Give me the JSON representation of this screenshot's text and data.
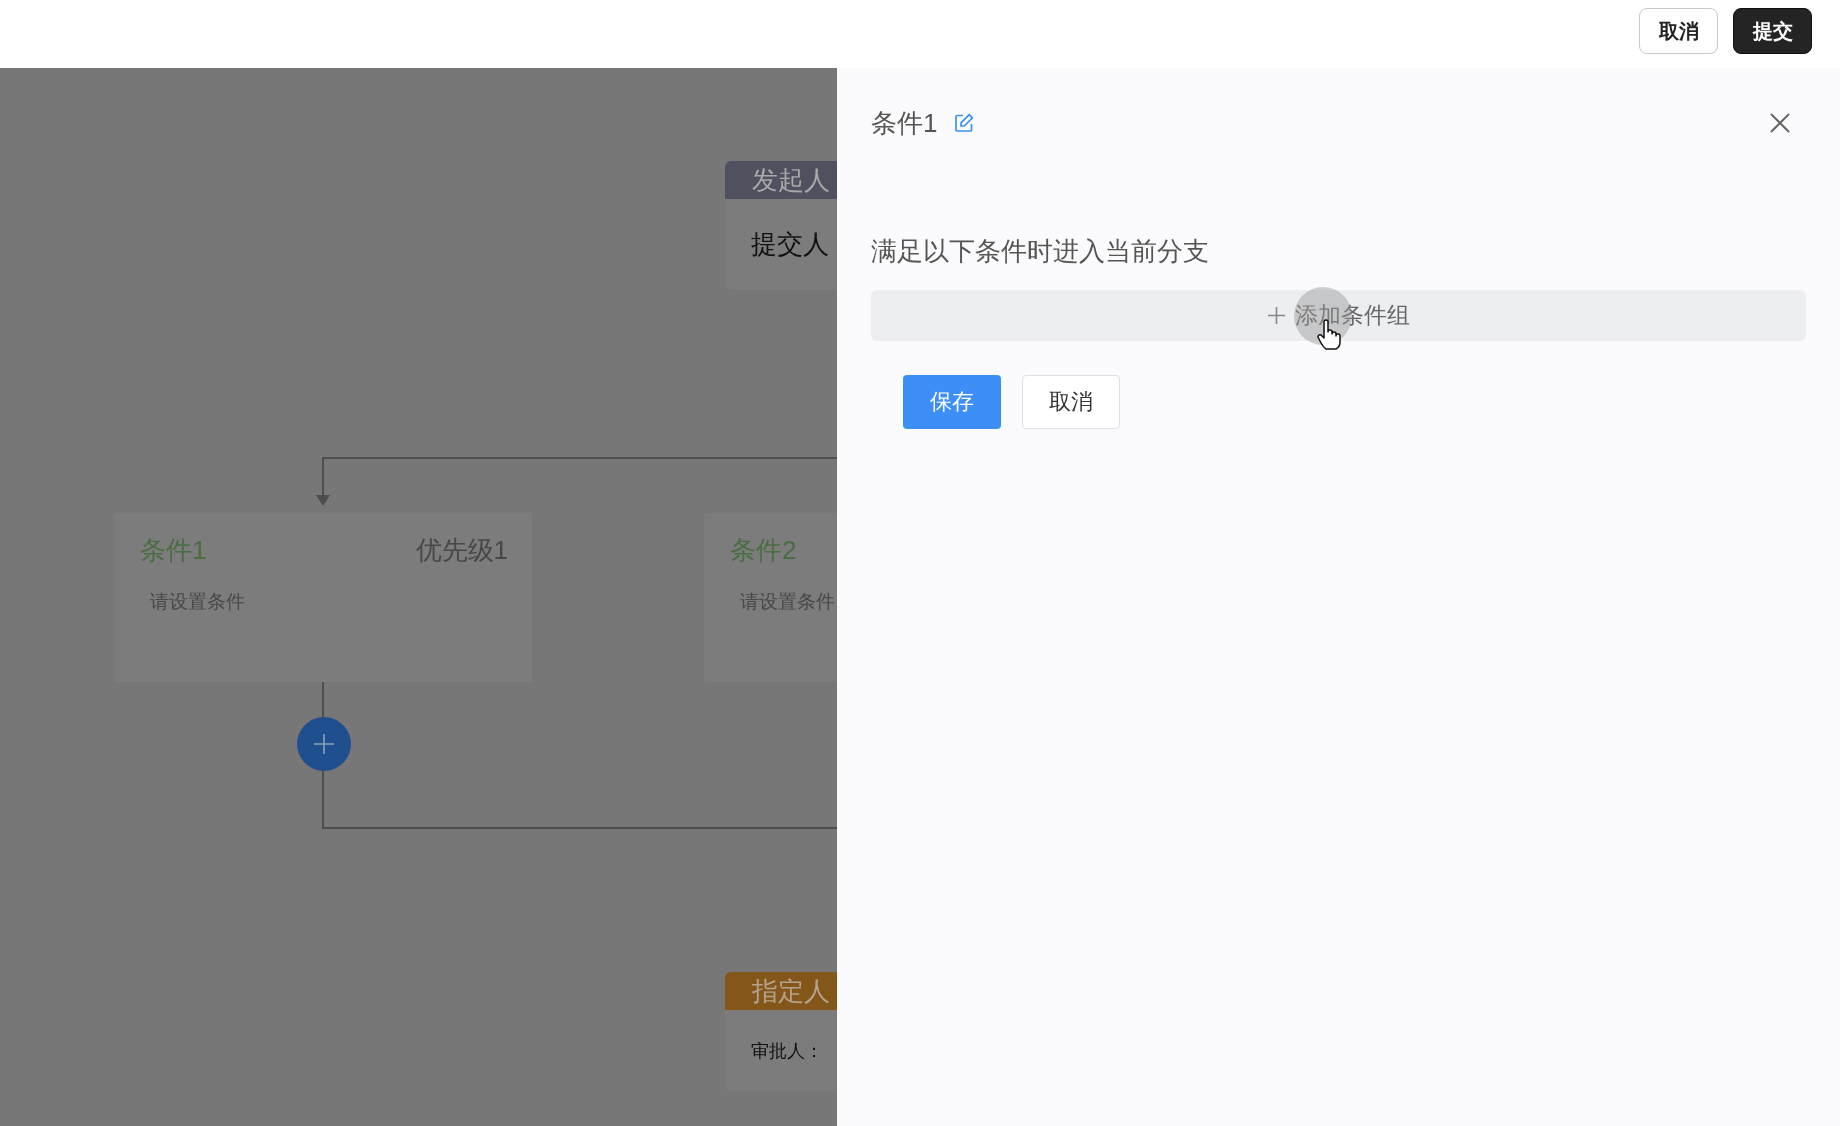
{
  "top_bar": {
    "buttons": [
      {
        "label": "取消",
        "kind": "default"
      },
      {
        "label": "提交",
        "kind": "primary"
      }
    ]
  },
  "canvas": {
    "nodes": [
      {
        "kind": "initiator",
        "title": "发起人",
        "content": "提交人"
      },
      {
        "kind": "approver",
        "title": "指定人",
        "content": "审批人："
      }
    ],
    "branches": [
      {
        "title": "条件1",
        "priority": "优先级1",
        "summary": "请设置条件"
      },
      {
        "title": "条件2",
        "summary": "请设置条件"
      }
    ]
  },
  "drawer": {
    "title": "条件1",
    "description": "满足以下条件时进入当前分支",
    "add_group": {
      "label": "添加条件组"
    },
    "buttons": [
      {
        "label": "保存",
        "kind": "primary"
      },
      {
        "label": "取消",
        "kind": "default"
      }
    ]
  }
}
